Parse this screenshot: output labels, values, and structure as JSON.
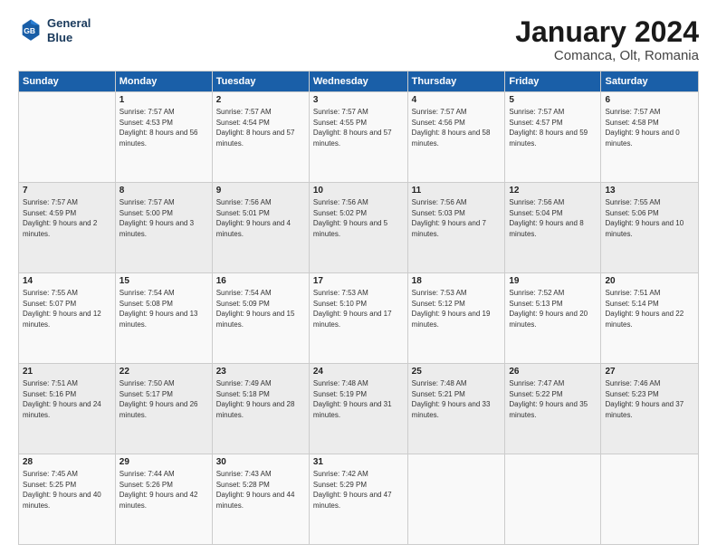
{
  "logo": {
    "line1": "General",
    "line2": "Blue"
  },
  "title": "January 2024",
  "subtitle": "Comanca, Olt, Romania",
  "header_days": [
    "Sunday",
    "Monday",
    "Tuesday",
    "Wednesday",
    "Thursday",
    "Friday",
    "Saturday"
  ],
  "weeks": [
    [
      {
        "day": "",
        "sunrise": "",
        "sunset": "",
        "daylight": ""
      },
      {
        "day": "1",
        "sunrise": "Sunrise: 7:57 AM",
        "sunset": "Sunset: 4:53 PM",
        "daylight": "Daylight: 8 hours and 56 minutes."
      },
      {
        "day": "2",
        "sunrise": "Sunrise: 7:57 AM",
        "sunset": "Sunset: 4:54 PM",
        "daylight": "Daylight: 8 hours and 57 minutes."
      },
      {
        "day": "3",
        "sunrise": "Sunrise: 7:57 AM",
        "sunset": "Sunset: 4:55 PM",
        "daylight": "Daylight: 8 hours and 57 minutes."
      },
      {
        "day": "4",
        "sunrise": "Sunrise: 7:57 AM",
        "sunset": "Sunset: 4:56 PM",
        "daylight": "Daylight: 8 hours and 58 minutes."
      },
      {
        "day": "5",
        "sunrise": "Sunrise: 7:57 AM",
        "sunset": "Sunset: 4:57 PM",
        "daylight": "Daylight: 8 hours and 59 minutes."
      },
      {
        "day": "6",
        "sunrise": "Sunrise: 7:57 AM",
        "sunset": "Sunset: 4:58 PM",
        "daylight": "Daylight: 9 hours and 0 minutes."
      }
    ],
    [
      {
        "day": "7",
        "sunrise": "Sunrise: 7:57 AM",
        "sunset": "Sunset: 4:59 PM",
        "daylight": "Daylight: 9 hours and 2 minutes."
      },
      {
        "day": "8",
        "sunrise": "Sunrise: 7:57 AM",
        "sunset": "Sunset: 5:00 PM",
        "daylight": "Daylight: 9 hours and 3 minutes."
      },
      {
        "day": "9",
        "sunrise": "Sunrise: 7:56 AM",
        "sunset": "Sunset: 5:01 PM",
        "daylight": "Daylight: 9 hours and 4 minutes."
      },
      {
        "day": "10",
        "sunrise": "Sunrise: 7:56 AM",
        "sunset": "Sunset: 5:02 PM",
        "daylight": "Daylight: 9 hours and 5 minutes."
      },
      {
        "day": "11",
        "sunrise": "Sunrise: 7:56 AM",
        "sunset": "Sunset: 5:03 PM",
        "daylight": "Daylight: 9 hours and 7 minutes."
      },
      {
        "day": "12",
        "sunrise": "Sunrise: 7:56 AM",
        "sunset": "Sunset: 5:04 PM",
        "daylight": "Daylight: 9 hours and 8 minutes."
      },
      {
        "day": "13",
        "sunrise": "Sunrise: 7:55 AM",
        "sunset": "Sunset: 5:06 PM",
        "daylight": "Daylight: 9 hours and 10 minutes."
      }
    ],
    [
      {
        "day": "14",
        "sunrise": "Sunrise: 7:55 AM",
        "sunset": "Sunset: 5:07 PM",
        "daylight": "Daylight: 9 hours and 12 minutes."
      },
      {
        "day": "15",
        "sunrise": "Sunrise: 7:54 AM",
        "sunset": "Sunset: 5:08 PM",
        "daylight": "Daylight: 9 hours and 13 minutes."
      },
      {
        "day": "16",
        "sunrise": "Sunrise: 7:54 AM",
        "sunset": "Sunset: 5:09 PM",
        "daylight": "Daylight: 9 hours and 15 minutes."
      },
      {
        "day": "17",
        "sunrise": "Sunrise: 7:53 AM",
        "sunset": "Sunset: 5:10 PM",
        "daylight": "Daylight: 9 hours and 17 minutes."
      },
      {
        "day": "18",
        "sunrise": "Sunrise: 7:53 AM",
        "sunset": "Sunset: 5:12 PM",
        "daylight": "Daylight: 9 hours and 19 minutes."
      },
      {
        "day": "19",
        "sunrise": "Sunrise: 7:52 AM",
        "sunset": "Sunset: 5:13 PM",
        "daylight": "Daylight: 9 hours and 20 minutes."
      },
      {
        "day": "20",
        "sunrise": "Sunrise: 7:51 AM",
        "sunset": "Sunset: 5:14 PM",
        "daylight": "Daylight: 9 hours and 22 minutes."
      }
    ],
    [
      {
        "day": "21",
        "sunrise": "Sunrise: 7:51 AM",
        "sunset": "Sunset: 5:16 PM",
        "daylight": "Daylight: 9 hours and 24 minutes."
      },
      {
        "day": "22",
        "sunrise": "Sunrise: 7:50 AM",
        "sunset": "Sunset: 5:17 PM",
        "daylight": "Daylight: 9 hours and 26 minutes."
      },
      {
        "day": "23",
        "sunrise": "Sunrise: 7:49 AM",
        "sunset": "Sunset: 5:18 PM",
        "daylight": "Daylight: 9 hours and 28 minutes."
      },
      {
        "day": "24",
        "sunrise": "Sunrise: 7:48 AM",
        "sunset": "Sunset: 5:19 PM",
        "daylight": "Daylight: 9 hours and 31 minutes."
      },
      {
        "day": "25",
        "sunrise": "Sunrise: 7:48 AM",
        "sunset": "Sunset: 5:21 PM",
        "daylight": "Daylight: 9 hours and 33 minutes."
      },
      {
        "day": "26",
        "sunrise": "Sunrise: 7:47 AM",
        "sunset": "Sunset: 5:22 PM",
        "daylight": "Daylight: 9 hours and 35 minutes."
      },
      {
        "day": "27",
        "sunrise": "Sunrise: 7:46 AM",
        "sunset": "Sunset: 5:23 PM",
        "daylight": "Daylight: 9 hours and 37 minutes."
      }
    ],
    [
      {
        "day": "28",
        "sunrise": "Sunrise: 7:45 AM",
        "sunset": "Sunset: 5:25 PM",
        "daylight": "Daylight: 9 hours and 40 minutes."
      },
      {
        "day": "29",
        "sunrise": "Sunrise: 7:44 AM",
        "sunset": "Sunset: 5:26 PM",
        "daylight": "Daylight: 9 hours and 42 minutes."
      },
      {
        "day": "30",
        "sunrise": "Sunrise: 7:43 AM",
        "sunset": "Sunset: 5:28 PM",
        "daylight": "Daylight: 9 hours and 44 minutes."
      },
      {
        "day": "31",
        "sunrise": "Sunrise: 7:42 AM",
        "sunset": "Sunset: 5:29 PM",
        "daylight": "Daylight: 9 hours and 47 minutes."
      },
      {
        "day": "",
        "sunrise": "",
        "sunset": "",
        "daylight": ""
      },
      {
        "day": "",
        "sunrise": "",
        "sunset": "",
        "daylight": ""
      },
      {
        "day": "",
        "sunrise": "",
        "sunset": "",
        "daylight": ""
      }
    ]
  ]
}
